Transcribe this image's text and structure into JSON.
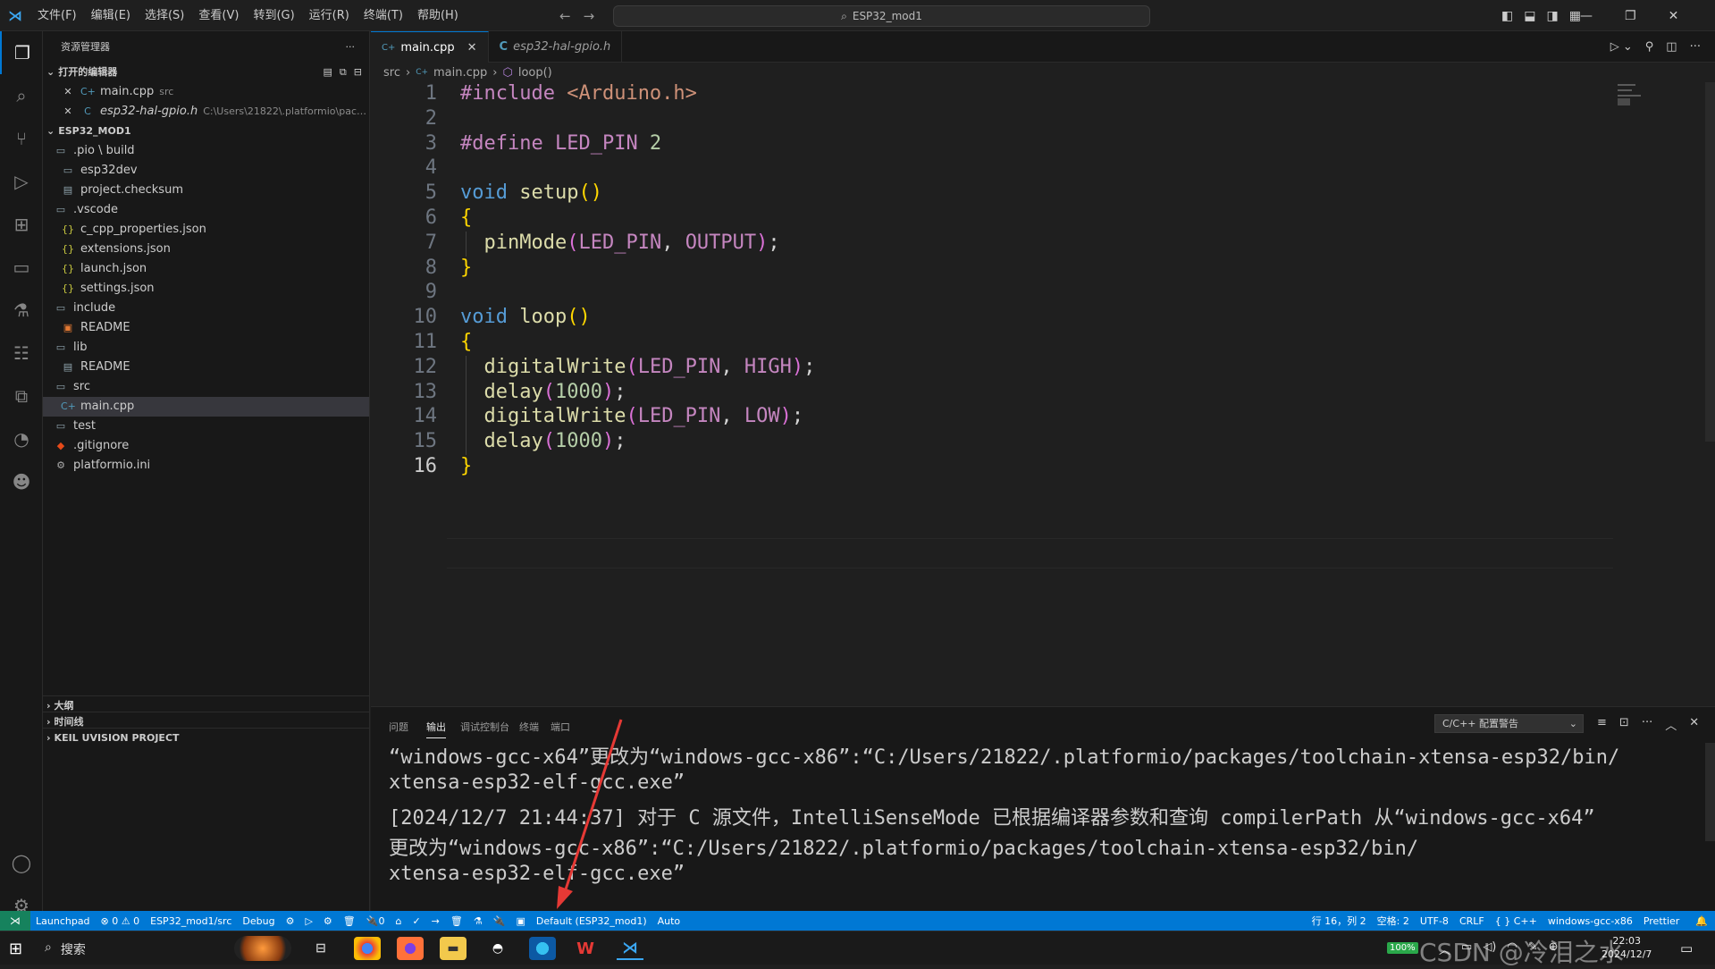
{
  "titlebar": {
    "menus": [
      "文件(F)",
      "编辑(E)",
      "选择(S)",
      "查看(V)",
      "转到(G)",
      "运行(R)",
      "终端(T)",
      "帮助(H)"
    ],
    "search": "ESP32_mod1"
  },
  "sidebar": {
    "title": "资源管理器",
    "open_editors_label": "打开的编辑器",
    "open_editors": [
      {
        "name": "main.cpp",
        "desc": "src"
      },
      {
        "name": "esp32-hal-gpio.h",
        "desc": "C:\\Users\\21822\\.platformio\\packages..."
      }
    ],
    "project_label": "ESP32_MOD1",
    "tree": [
      {
        "name": ".pio \\ build",
        "depth": 0,
        "icon": "folder-icon"
      },
      {
        "name": "esp32dev",
        "depth": 1,
        "icon": "folder-icon"
      },
      {
        "name": "project.checksum",
        "depth": 1,
        "icon": "file-icon"
      },
      {
        "name": ".vscode",
        "depth": 0,
        "icon": "folder-icon"
      },
      {
        "name": "c_cpp_properties.json",
        "depth": 1,
        "icon": "json-icon"
      },
      {
        "name": "extensions.json",
        "depth": 1,
        "icon": "json-icon"
      },
      {
        "name": "launch.json",
        "depth": 1,
        "icon": "json-icon"
      },
      {
        "name": "settings.json",
        "depth": 1,
        "icon": "json-icon"
      },
      {
        "name": "include",
        "depth": 0,
        "icon": "folder-icon"
      },
      {
        "name": "README",
        "depth": 1,
        "icon": "readme-icon"
      },
      {
        "name": "lib",
        "depth": 0,
        "icon": "folder-icon"
      },
      {
        "name": "README",
        "depth": 1,
        "icon": "file-icon"
      },
      {
        "name": "src",
        "depth": 0,
        "icon": "folder-icon"
      },
      {
        "name": "main.cpp",
        "depth": 1,
        "icon": "cpp-icon",
        "selected": true
      },
      {
        "name": "test",
        "depth": 0,
        "icon": "folder-icon"
      },
      {
        "name": ".gitignore",
        "depth": 0,
        "icon": "git-icon"
      },
      {
        "name": "platformio.ini",
        "depth": 0,
        "icon": "gear-icon"
      }
    ],
    "outline_label": "大纲",
    "timeline_label": "时间线",
    "keil_label": "KEIL UVISION PROJECT"
  },
  "editor": {
    "tabs": [
      {
        "label": "main.cpp",
        "active": true
      },
      {
        "label": "esp32-hal-gpio.h",
        "active": false
      }
    ],
    "breadcrumb": [
      "src",
      "main.cpp",
      "loop()"
    ],
    "line_numbers": [
      "1",
      "2",
      "3",
      "4",
      "5",
      "6",
      "7",
      "8",
      "9",
      "10",
      "11",
      "12",
      "13",
      "14",
      "15",
      "16"
    ],
    "lines": [
      [
        [
          "pp",
          "#include "
        ],
        [
          "str",
          "<Arduino.h>"
        ]
      ],
      [],
      [
        [
          "pp",
          "#define "
        ],
        [
          "mac",
          "LED_PIN"
        ],
        [
          "num",
          " 2"
        ]
      ],
      [],
      [
        [
          "kw",
          "void "
        ],
        [
          "fn",
          "setup"
        ],
        [
          "br",
          "()"
        ]
      ],
      [
        [
          "br",
          "{"
        ]
      ],
      [
        [
          "plain",
          "  "
        ],
        [
          "fn",
          "pinMode"
        ],
        [
          "br2",
          "("
        ],
        [
          "mac",
          "LED_PIN"
        ],
        [
          "plain",
          ", "
        ],
        [
          "mac",
          "OUTPUT"
        ],
        [
          "br2",
          ")"
        ],
        [
          "plain",
          ";"
        ]
      ],
      [
        [
          "br",
          "}"
        ]
      ],
      [],
      [
        [
          "kw",
          "void "
        ],
        [
          "fn",
          "loop"
        ],
        [
          "br",
          "()"
        ]
      ],
      [
        [
          "br",
          "{"
        ]
      ],
      [
        [
          "plain",
          "  "
        ],
        [
          "fn",
          "digitalWrite"
        ],
        [
          "br2",
          "("
        ],
        [
          "mac",
          "LED_PIN"
        ],
        [
          "plain",
          ", "
        ],
        [
          "mac",
          "HIGH"
        ],
        [
          "br2",
          ")"
        ],
        [
          "plain",
          ";"
        ]
      ],
      [
        [
          "plain",
          "  "
        ],
        [
          "fn",
          "delay"
        ],
        [
          "br2",
          "("
        ],
        [
          "num",
          "1000"
        ],
        [
          "br2",
          ")"
        ],
        [
          "plain",
          ";"
        ]
      ],
      [
        [
          "plain",
          "  "
        ],
        [
          "fn",
          "digitalWrite"
        ],
        [
          "br2",
          "("
        ],
        [
          "mac",
          "LED_PIN"
        ],
        [
          "plain",
          ", "
        ],
        [
          "mac",
          "LOW"
        ],
        [
          "br2",
          ")"
        ],
        [
          "plain",
          ";"
        ]
      ],
      [
        [
          "plain",
          "  "
        ],
        [
          "fn",
          "delay"
        ],
        [
          "br2",
          "("
        ],
        [
          "num",
          "1000"
        ],
        [
          "br2",
          ")"
        ],
        [
          "plain",
          ";"
        ]
      ],
      [
        [
          "br",
          "}"
        ]
      ]
    ]
  },
  "panel": {
    "tabs": [
      "问题",
      "输出",
      "调试控制台",
      "终端",
      "端口"
    ],
    "active_tab": "输出",
    "channel": "C/C++ 配置警告",
    "output": [
      "“windows-gcc-x64”更改为“windows-gcc-x86”:“C:/Users/21822/.platformio/packages/toolchain-xtensa-esp32/bin/",
      "xtensa-esp32-elf-gcc.exe”",
      "[2024/12/7 21:44:37] 对于 C 源文件，IntelliSenseMode 已根据编译器参数和查询 compilerPath 从“windows-gcc-x64”",
      "更改为“windows-gcc-x86”:“C:/Users/21822/.platformio/packages/toolchain-xtensa-esp32/bin/",
      "xtensa-esp32-elf-gcc.exe”"
    ]
  },
  "statusbar": {
    "left": [
      "Launchpad",
      "⊗ 0 ⚠ 0",
      "ESP32_mod1/src",
      "Debug",
      "⚙",
      "▷",
      "⚙",
      "🗑",
      "🔌0",
      "⌂",
      "✓",
      "→",
      "🗑",
      "⚗",
      "🔌",
      "▣",
      "Default (ESP32_mod1)",
      "Auto"
    ],
    "right": [
      "行 16，列 2",
      "空格: 2",
      "UTF-8",
      "CRLF",
      "{ } C++",
      "windows-gcc-x86",
      "Prettier"
    ]
  },
  "taskbar": {
    "search": "搜索",
    "battery": "100%",
    "time": "22:03",
    "date": "2024/12/7",
    "watermark": "CSDN @冷泪之水"
  },
  "colors": {
    "accent": "#0078d4",
    "statusbar": "#0078d4",
    "remote": "#16825d"
  }
}
